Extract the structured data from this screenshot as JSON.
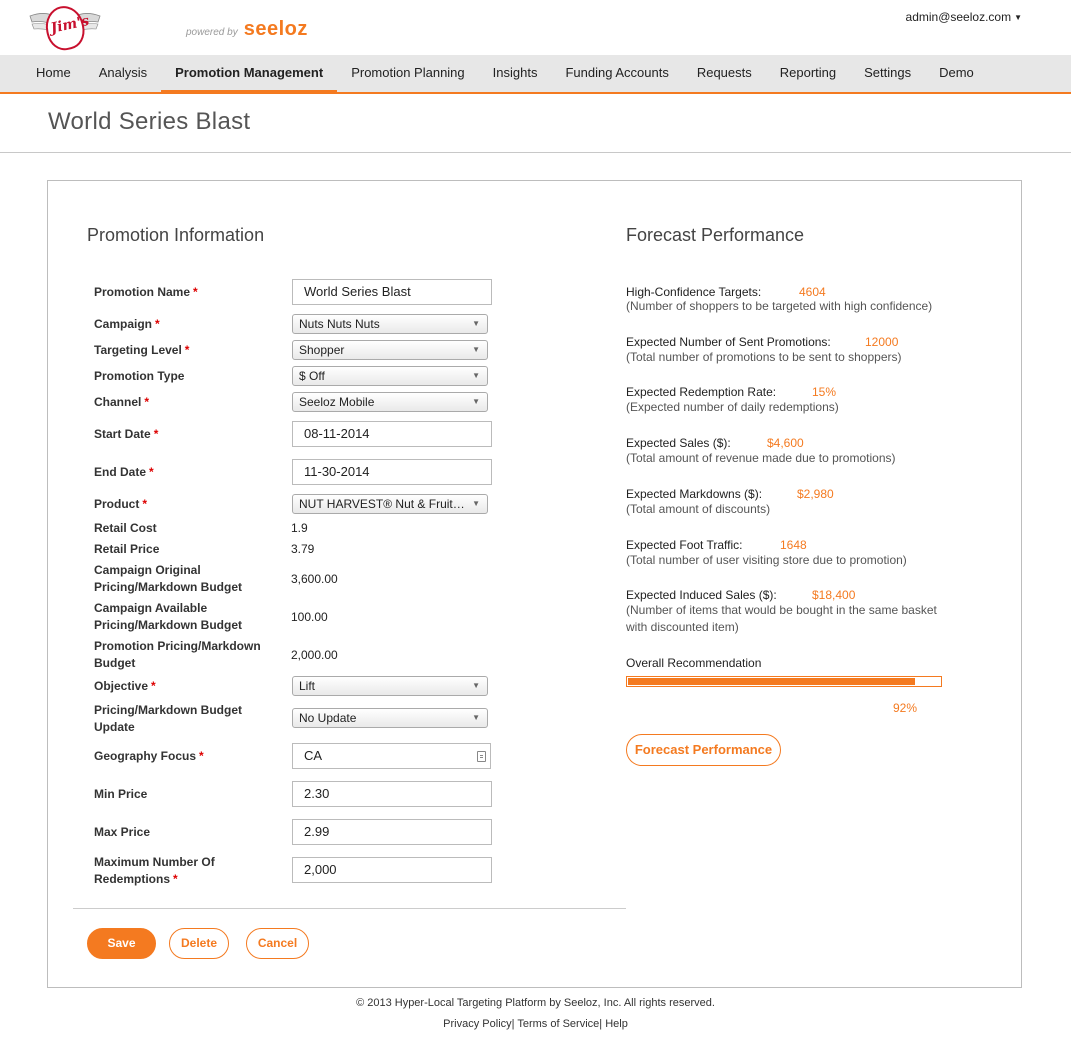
{
  "header": {
    "logo_text": "Jim's",
    "powered_by": "powered by",
    "brand": "seeloz",
    "user": "admin@seeloz.com"
  },
  "nav": {
    "items": [
      "Home",
      "Analysis",
      "Promotion Management",
      "Promotion Planning",
      "Insights",
      "Funding Accounts",
      "Requests",
      "Reporting",
      "Settings",
      "Demo"
    ],
    "active": "Promotion Management"
  },
  "page": {
    "title": "World Series Blast"
  },
  "promotion_info": {
    "section_title": "Promotion Information",
    "labels": {
      "promotion_name": "Promotion Name",
      "campaign": "Campaign",
      "targeting_level": "Targeting Level",
      "promotion_type": "Promotion Type",
      "channel": "Channel",
      "start_date": "Start Date",
      "end_date": "End Date",
      "product": "Product",
      "retail_cost": "Retail Cost",
      "retail_price": "Retail Price",
      "campaign_original_budget": "Campaign Original Pricing/Markdown Budget",
      "campaign_available_budget": "Campaign Available Pricing/Markdown Budget",
      "promotion_budget": "Promotion Pricing/Markdown Budget",
      "objective": "Objective",
      "budget_update": "Pricing/Markdown Budget Update",
      "geography_focus": "Geography Focus",
      "min_price": "Min Price",
      "max_price": "Max Price",
      "max_redemptions": "Maximum Number Of Redemptions"
    },
    "required_mark": "*",
    "values": {
      "promotion_name": "World Series Blast",
      "campaign": "Nuts Nuts Nuts",
      "targeting_level": "Shopper",
      "promotion_type": "$ Off",
      "channel": "Seeloz Mobile",
      "start_date": "08-11-2014",
      "end_date": "11-30-2014",
      "product": "NUT HARVEST® Nut & Fruit…",
      "retail_cost": "1.9",
      "retail_price": "3.79",
      "campaign_original_budget": "3,600.00",
      "campaign_available_budget": "100.00",
      "promotion_budget": "2,000.00",
      "objective": "Lift",
      "budget_update": "No Update",
      "geography_focus": "CA",
      "min_price": "2.30",
      "max_price": "2.99",
      "max_redemptions": "2,000"
    }
  },
  "actions": {
    "save": "Save",
    "delete": "Delete",
    "cancel": "Cancel"
  },
  "forecast": {
    "section_title": "Forecast Performance",
    "metrics": [
      {
        "label": "High-Confidence Targets:",
        "value": "4604",
        "desc": "(Number of shoppers to be targeted with high confidence)"
      },
      {
        "label": "Expected Number of Sent Promotions:",
        "value": "12000",
        "desc": "(Total number of promotions to be sent to shoppers)"
      },
      {
        "label": "Expected Redemption Rate:",
        "value": "15%",
        "desc": "(Expected number of daily redemptions)"
      },
      {
        "label": "Expected Sales ($):",
        "value": "$4,600",
        "desc": "(Total amount of revenue made due to promotions)"
      },
      {
        "label": "Expected Markdowns ($):",
        "value": "$2,980",
        "desc": "(Total amount of discounts)"
      },
      {
        "label": "Expected Foot Traffic:",
        "value": "1648",
        "desc": "(Total number of user visiting store due to promotion)"
      },
      {
        "label": "Expected Induced Sales ($):",
        "value": "$18,400",
        "desc": "(Number of items that would be bought in the same basket with discounted item)"
      }
    ],
    "recommendation_label": "Overall Recommendation",
    "recommendation_value": 92,
    "recommendation_text": "92%",
    "button": "Forecast Performance"
  },
  "footer": {
    "copyright": "© 2013 Hyper-Local Targeting Platform by Seeloz, Inc. All rights reserved.",
    "links": [
      "Privacy Policy",
      "Terms of Service",
      "Help"
    ]
  },
  "colors": {
    "accent": "#f47a20",
    "nav_bg": "#e7e7e7",
    "required": "#dd0000"
  }
}
